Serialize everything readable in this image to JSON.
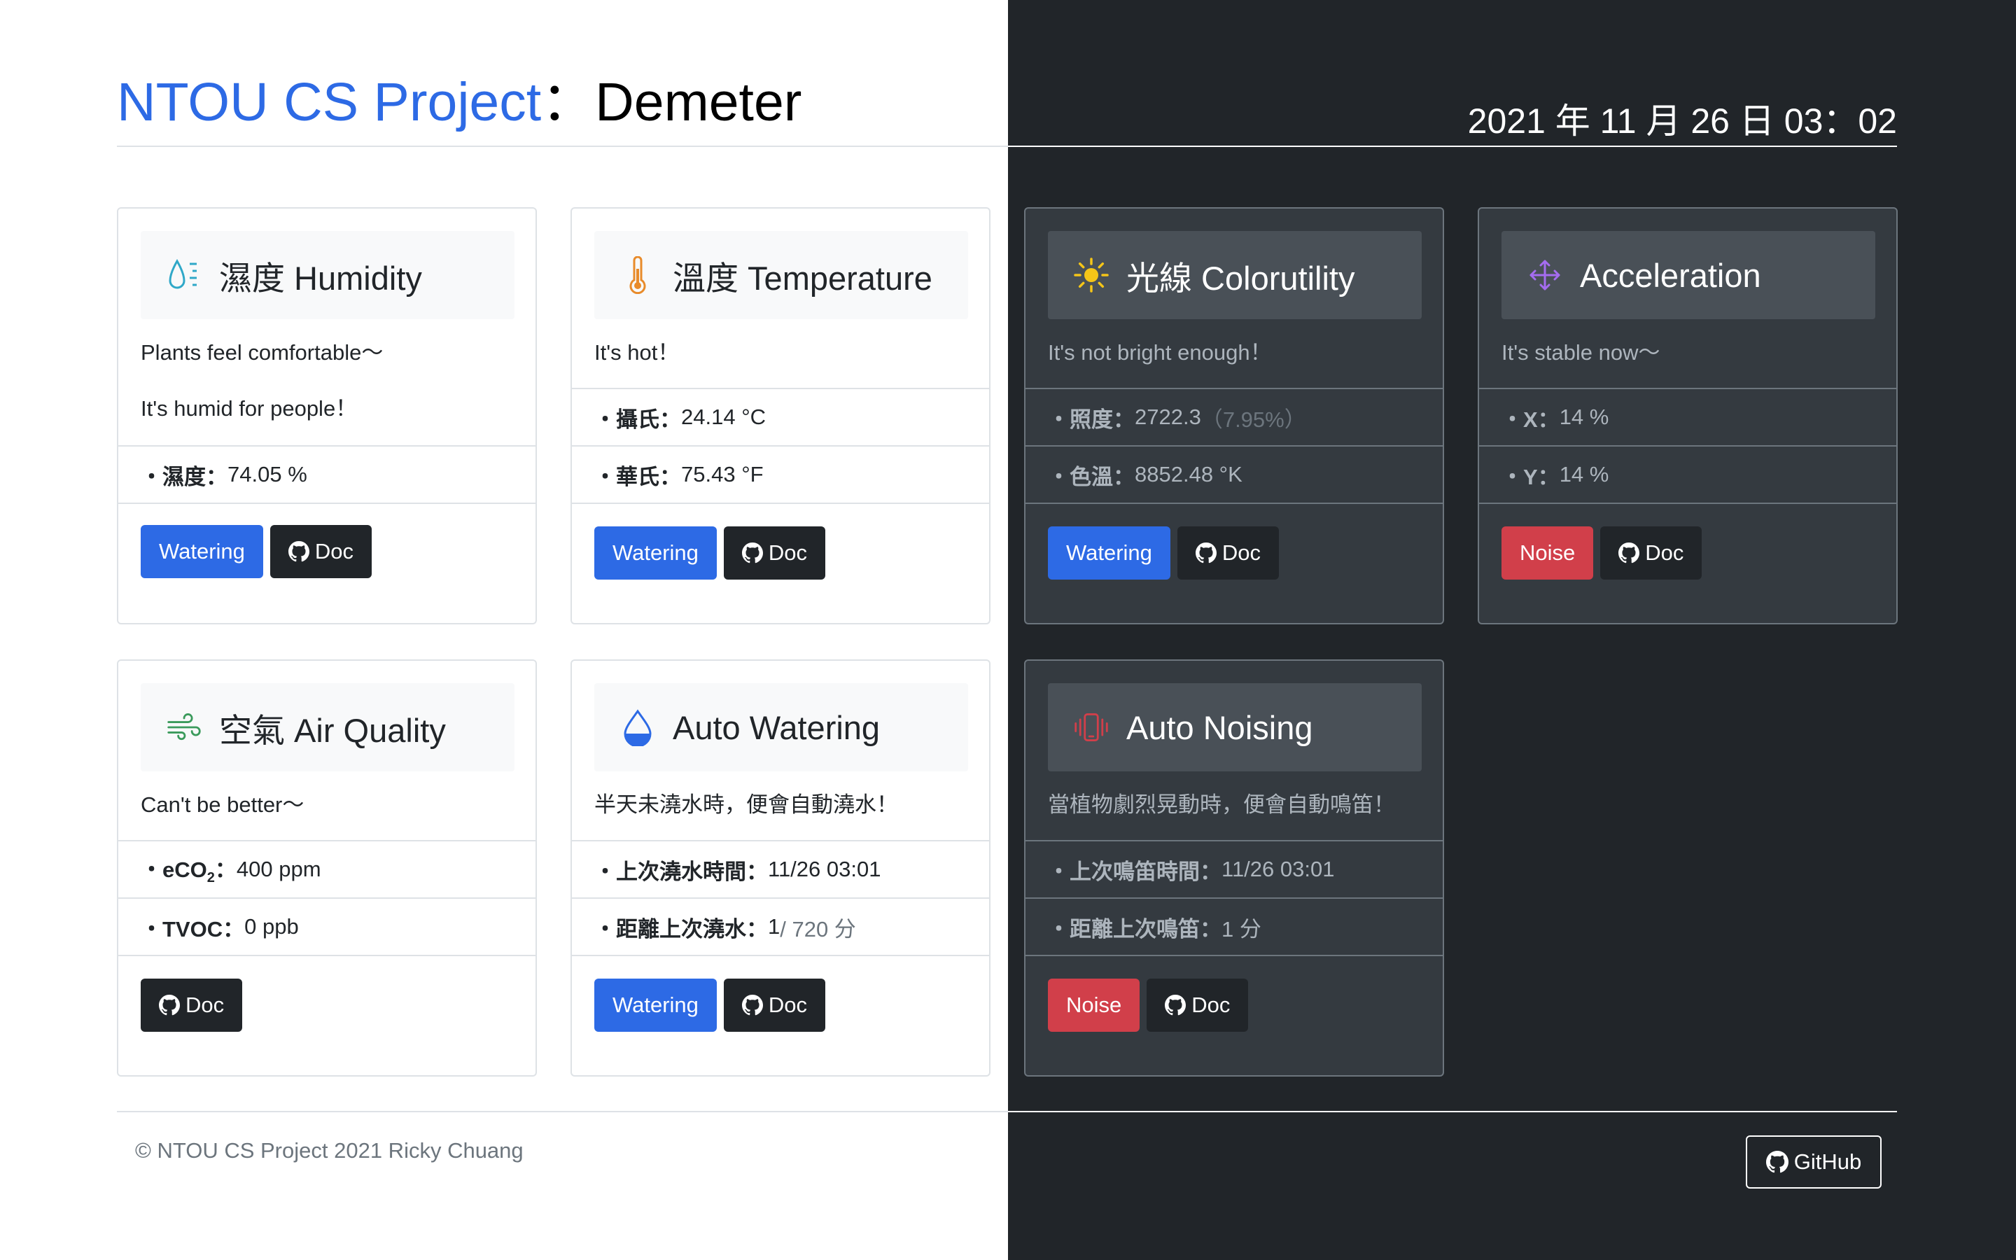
{
  "header": {
    "brand": "NTOU CS Project",
    "separator": "：",
    "name": "Demeter",
    "datetime": "2021 年 11 月 26 日 03：02"
  },
  "cards": {
    "humidity": {
      "title": "濕度 Humidity",
      "icon": "humidity-icon",
      "desc1": "Plants feel comfortable～",
      "desc2": "It's humid for people！",
      "r1_key": "・濕度：",
      "r1_val": "74.05 %",
      "btn1": "Watering",
      "btn2": "Doc"
    },
    "temperature": {
      "title": "溫度 Temperature",
      "icon": "thermometer-icon",
      "desc1": "It's hot！",
      "r1_key": "・攝氏：",
      "r1_val": "24.14 °C",
      "r2_key": "・華氏：",
      "r2_val": "75.43 °F",
      "btn1": "Watering",
      "btn2": "Doc"
    },
    "light": {
      "title": "光線 Colorutility",
      "icon": "sun-icon",
      "desc1": "It's not bright enough！",
      "r1_key": "・照度：",
      "r1_val": "2722.3",
      "r1_muted": "（7.95%）",
      "r2_key": "・色溫：",
      "r2_val": "8852.48 °K",
      "btn1": "Watering",
      "btn2": "Doc"
    },
    "acceleration": {
      "title": "Acceleration",
      "icon": "arrows-move-icon",
      "desc1": "It's stable now～",
      "r1_key": "・X：",
      "r1_val": "14 %",
      "r2_key": "・Y：",
      "r2_val": "14 %",
      "btn1": "Noise",
      "btn2": "Doc"
    },
    "air": {
      "title": "空氣 Air Quality",
      "icon": "wind-icon",
      "desc1": "Can't be better～",
      "r1_key_a": "・",
      "r1_key_b": "eCO",
      "r1_key_sub": "2",
      "r1_key_c": "：",
      "r1_val": "400 ppm",
      "r2_key": "・TVOC：",
      "r2_val": "0 ppb",
      "btn1": "Doc"
    },
    "autowater": {
      "title": "Auto Watering",
      "icon": "droplet-icon",
      "desc1": "半天未澆水時，便會自動澆水！",
      "r1_key": "・上次澆水時間：",
      "r1_val": "11/26 03:01",
      "r2_key": "・距離上次澆水：",
      "r2_val": "1",
      "r2_muted": " / 720 分",
      "btn1": "Watering",
      "btn2": "Doc"
    },
    "autonoise": {
      "title": "Auto Noising",
      "icon": "phone-vibrate-icon",
      "desc1": "當植物劇烈晃動時，便會自動鳴笛！",
      "r1_key": "・上次鳴笛時間：",
      "r1_val": "11/26 03:01",
      "r2_key": "・距離上次鳴笛：",
      "r2_val": "1 分",
      "btn1": "Noise",
      "btn2": "Doc"
    }
  },
  "footer": {
    "copyright": "© NTOU CS Project 2021 Ricky Chuang",
    "github": "GitHub"
  },
  "colors": {
    "primary": "#2d6ae5",
    "danger": "#d13f4a",
    "dark": "#212529",
    "card_dark": "#343a40"
  }
}
